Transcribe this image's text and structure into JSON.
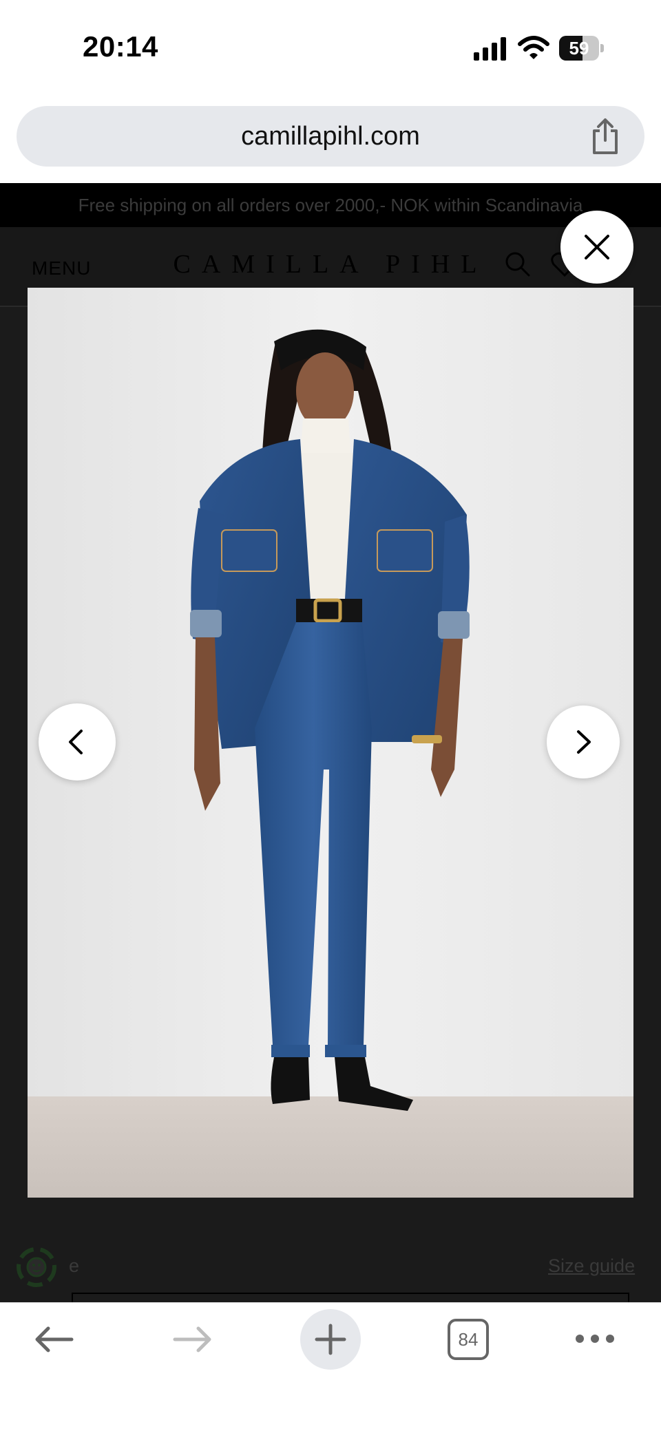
{
  "status_bar": {
    "time": "20:14",
    "battery_level": "59",
    "battery_fraction": 0.59,
    "icons": [
      "signal-icon",
      "wifi-icon",
      "battery-icon"
    ]
  },
  "browser": {
    "url": "camillapihl.com",
    "tab_count": "84",
    "icons": [
      "share-icon",
      "back-arrow-icon",
      "forward-arrow-icon",
      "plus-icon",
      "more-icon"
    ]
  },
  "site": {
    "promo_text": "Free shipping on all orders over 2000,- NOK within Scandinavia",
    "menu_label": "MENU",
    "logo_text": "CAMILLA PIHL",
    "size_label_fragment": "e",
    "size_guide_link": "Size guide",
    "icons": [
      "search-icon",
      "heart-icon",
      "accessibility-icon"
    ]
  },
  "lightbox": {
    "icons": [
      "close-icon",
      "chevron-left-icon",
      "chevron-right-icon"
    ]
  },
  "colors": {
    "denim": "#2f5b92",
    "backdrop": "#1b1b1b",
    "url_pill": "#e6e8ec"
  }
}
